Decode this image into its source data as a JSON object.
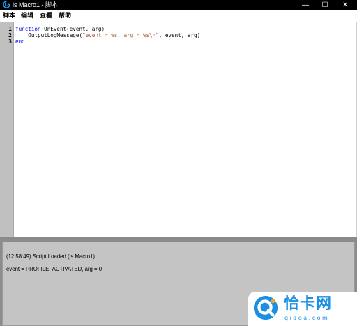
{
  "window": {
    "title": "ls Macro1 - 脚本",
    "controls": {
      "minimize": "—",
      "maximize": "☐",
      "close": "✕"
    }
  },
  "menu": [
    "脚本",
    "编辑",
    "查看",
    "帮助"
  ],
  "editor": {
    "line_numbers": [
      "1",
      "2",
      "3"
    ],
    "code": {
      "line1": {
        "keyword": "function",
        "rest": " OnEvent(event, arg)"
      },
      "line2": {
        "indent": "    ",
        "call": "OutputLogMessage(",
        "string": "\"event = %s, arg = %s\\n\"",
        "rest": ", event, arg)"
      },
      "line3": {
        "keyword": "end"
      }
    }
  },
  "output": {
    "lines": [
      "(12:58:49) Script Loaded (ls Macro1)",
      "event = PROFILE_ACTIVATED, arg = 0"
    ]
  },
  "watermark": {
    "name": "恰卡网",
    "domain": "qiaqa.com"
  },
  "colors": {
    "titlebar": "#000000",
    "keyword": "#0000ff",
    "string": "#a0522d",
    "gutter": "#c0c0c0",
    "output_bg": "#c4c4c4",
    "watermark": "#1b8fe3"
  },
  "icons": {
    "app": "logitech-g-icon",
    "minimize": "minimize-icon",
    "maximize": "maximize-icon",
    "close": "close-icon"
  }
}
